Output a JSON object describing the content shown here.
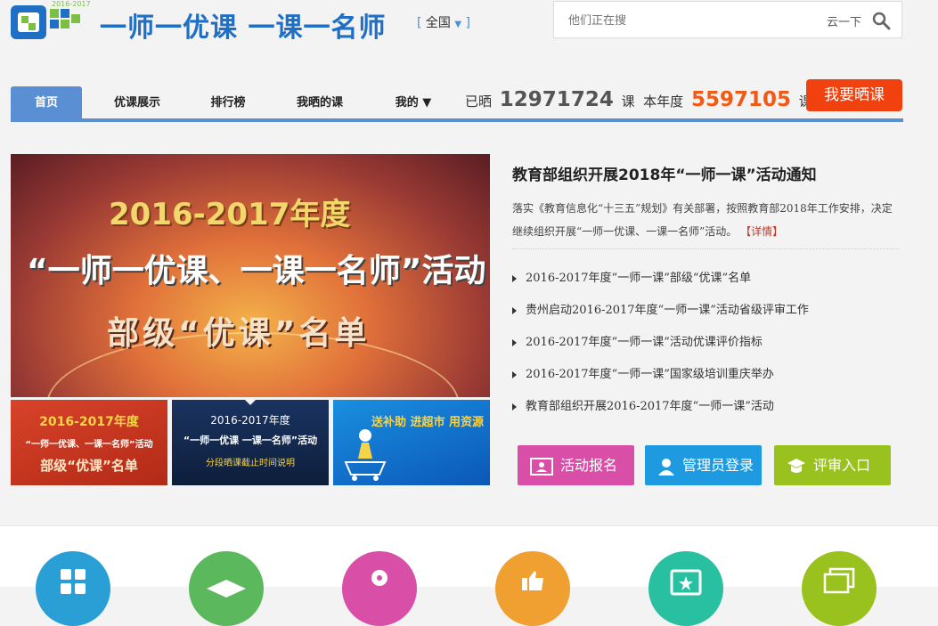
{
  "header": {
    "logo_year": "2016-2017",
    "slogan": "一师一优课  一课一名师",
    "region_label": "全国",
    "search": {
      "placeholder": "他们正在搜",
      "hint": "云一下"
    }
  },
  "nav": {
    "tabs": [
      {
        "label": "首页",
        "active": true
      },
      {
        "label": "优课展示"
      },
      {
        "label": "排行榜"
      },
      {
        "label": "我晒的课"
      },
      {
        "label": "我的 ▼"
      }
    ],
    "stats": {
      "prefix": "已晒",
      "total": "12971724",
      "unit1": "课",
      "year_label": "本年度",
      "year_total": "5597105",
      "unit2": "课"
    },
    "show_button": "我要晒课"
  },
  "banner": {
    "line1": "2016-2017年度",
    "line2": "“一师一优课、一课一名师”活动",
    "line3": "部级“优课”名单"
  },
  "thumbs": [
    {
      "lines": [
        "2016-2017年度",
        "“一师一优课、一课一名师”活动",
        "部级“优课”名单"
      ]
    },
    {
      "lines": [
        "2016-2017年度",
        "“一师一优课 一课一名师”活动",
        "分段晒课截止时间说明"
      ]
    },
    {
      "lines": [
        "送补助 进超市 用资源"
      ]
    }
  ],
  "news": {
    "headline": "教育部组织开展2018年“一师一课”活动通知",
    "summary": "落实《教育信息化“十三五”规划》有关部署，按照教育部2018年工作安排，决定继续组织开展“一师一优课、一课一名师”活动。",
    "more": "【详情】",
    "items": [
      "2016-2017年度“一师一课”部级“优课”名单",
      "贵州启动2016-2017年度“一师一课”活动省级评审工作",
      "2016-2017年度“一师一课”活动优课评价指标",
      "2016-2017年度“一师一课”国家级培训重庆举办",
      "教育部组织开展2016-2017年度“一师一课”活动"
    ]
  },
  "actions": {
    "register": "活动报名",
    "admin_login": "管理员登录",
    "review": "评审入口"
  },
  "colors": {
    "brand_blue": "#1f6fc5",
    "nav_blue": "#5b8fd4",
    "accent_orange": "#f05a14",
    "show_red": "#f0410f",
    "pink": "#d94fa8",
    "blue": "#1e9ae0",
    "green": "#9ac21e"
  },
  "feature_icons": [
    {
      "icon": "grid-icon",
      "color": "#2a9fd6"
    },
    {
      "icon": "graduation-cap-icon",
      "color": "#5cb85c"
    },
    {
      "icon": "key-icon",
      "color": "#d94fa8"
    },
    {
      "icon": "thumb-up-icon",
      "color": "#f0a030"
    },
    {
      "icon": "star-frame-icon",
      "color": "#28c0a0"
    },
    {
      "icon": "photos-icon",
      "color": "#9ac21e"
    }
  ]
}
